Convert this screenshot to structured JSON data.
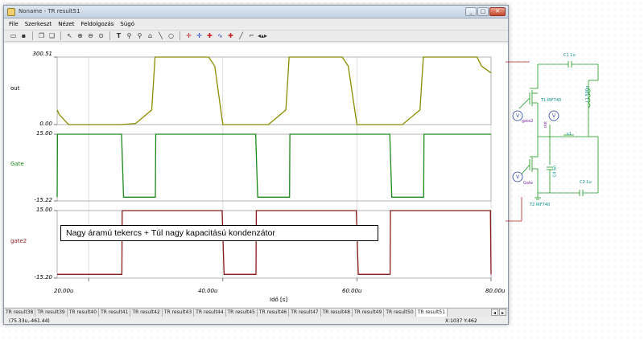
{
  "window": {
    "title": "Noname - TR result51",
    "buttons": [
      "_",
      "□",
      "✕"
    ]
  },
  "menu": [
    "File",
    "Szerkeszt",
    "Nézet",
    "Feldolgozás",
    "Súgó"
  ],
  "toolbar": {
    "icons": [
      "open-icon",
      "save-icon",
      "copy-icon",
      "paste-icon",
      "pointer-icon",
      "zoom-in-icon",
      "zoom-out-icon",
      "zoom-fit-icon",
      "text-icon",
      "cursor-a-icon",
      "cursor-b-icon",
      "wave-icon",
      "line-icon",
      "circle-icon",
      "crosshair-icon",
      "crosshair2-icon",
      "marker-icon",
      "marker2-icon",
      "marker3-icon",
      "tangent-icon",
      "slope-icon",
      "arrows-icon"
    ]
  },
  "chart_data": [
    {
      "type": "line",
      "channel": "out",
      "color": "#8b8b00",
      "ylim": [
        0.0,
        300.51
      ],
      "yticks": [
        "300.51",
        "0.00"
      ],
      "xlim": [
        15.3,
        80.0
      ],
      "series": [
        {
          "name": "out",
          "x": [
            15.3,
            15.6,
            17.0,
            24.8,
            27.0,
            29.4,
            29.9,
            37.9,
            38.8,
            40.0,
            46.8,
            49.4,
            49.9,
            57.8,
            58.7,
            60.0,
            66.8,
            69.4,
            69.9,
            77.9,
            78.6,
            80.0
          ],
          "y": [
            65,
            45,
            0,
            0,
            5,
            65,
            300.51,
            300.51,
            260,
            0,
            0,
            65,
            300.51,
            300.51,
            260,
            0,
            0,
            65,
            300.51,
            300.51,
            260,
            230
          ]
        }
      ]
    },
    {
      "type": "line",
      "channel": "Gate",
      "color": "#1a8a1a",
      "ylim": [
        -15.22,
        15.0
      ],
      "yticks": [
        "15.00",
        "-15.22"
      ],
      "xlim": [
        15.3,
        80.0
      ],
      "series": [
        {
          "name": "Gate",
          "x": [
            15.3,
            15.35,
            24.9,
            25.2,
            29.95,
            30.0,
            44.9,
            45.2,
            49.95,
            50.0,
            64.9,
            65.2,
            69.95,
            70.0,
            80.0
          ],
          "y": [
            -13.5,
            15.0,
            15.0,
            -13.5,
            -13.5,
            15.0,
            15.0,
            -13.5,
            -13.5,
            15.0,
            15.0,
            -13.5,
            -13.5,
            15.0,
            15.0
          ]
        }
      ]
    },
    {
      "type": "line",
      "channel": "gate2",
      "color": "#8b1a1a",
      "ylim": [
        -15.2,
        15.0
      ],
      "yticks": [
        "15.00",
        "-15.20"
      ],
      "xlim": [
        15.3,
        80.0
      ],
      "xticks": [
        "20.00u",
        "40.00u",
        "60.00u",
        "80.00u"
      ],
      "xlabel": "Idő [s]",
      "series": [
        {
          "name": "gate2",
          "x": [
            15.3,
            24.95,
            25.0,
            39.9,
            40.2,
            44.95,
            45.0,
            59.9,
            60.2,
            64.95,
            65.0,
            79.9,
            80.0
          ],
          "y": [
            -13.5,
            -13.5,
            15.0,
            15.0,
            -13.5,
            -13.5,
            15.0,
            15.0,
            -13.5,
            -13.5,
            15.0,
            15.0,
            -13.5
          ]
        }
      ]
    }
  ],
  "annotation": "Nagy áramú tekercs + Túl nagy kapacitású kondenzátor",
  "tabs": [
    "TR result38",
    "TR result39",
    "TR result40",
    "TR result41",
    "TR result42",
    "TR result43",
    "TR result44",
    "TR result45",
    "TR result46",
    "TR result47",
    "TR result48",
    "TR result49",
    "TR result50",
    "TR result51"
  ],
  "active_tab": "TR result51",
  "status": {
    "left": "(75.33u,-461.44)",
    "right": "X:1037  Y:462"
  },
  "schematic": {
    "labels": {
      "c1": "C1 1u",
      "t1": "T1 IRF740",
      "l1": "L1 500u",
      "gate2": "gate2",
      "out": "out",
      "s1": "s1",
      "c4": "C4 6n",
      "gate": "Gate",
      "c2": "C2 1u",
      "t2": "T2 IRF740"
    }
  }
}
